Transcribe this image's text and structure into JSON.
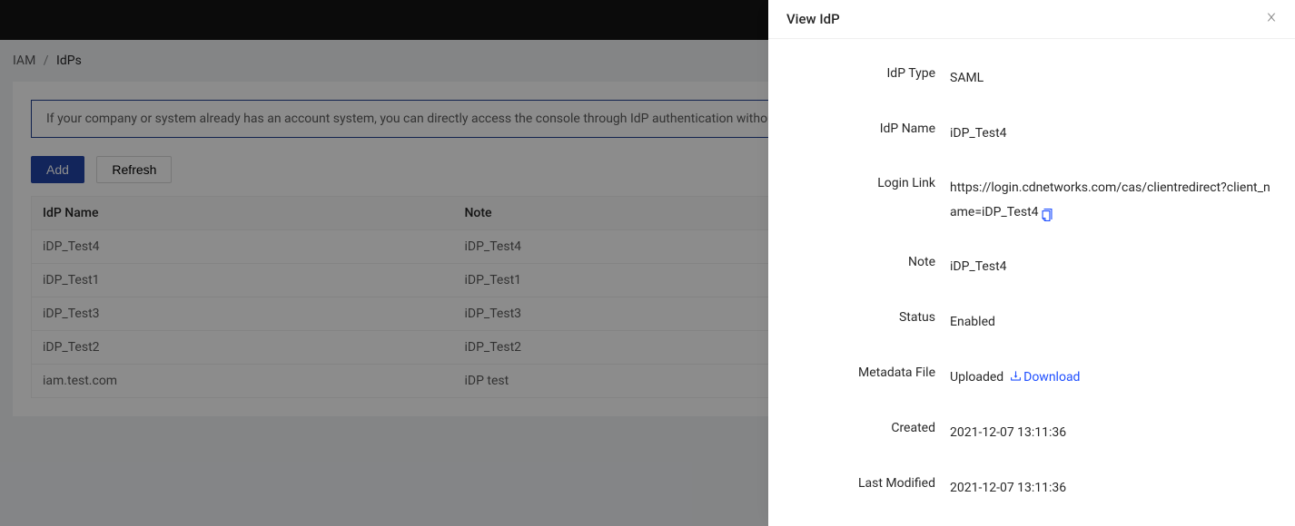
{
  "breadcrumb": {
    "root": "IAM",
    "current": "IdPs"
  },
  "info": {
    "text": "If your company or system already has an account system, you can directly access the console through IdP authentication without"
  },
  "actions": {
    "add_label": "Add",
    "refresh_label": "Refresh"
  },
  "table": {
    "headers": {
      "name": "IdP Name",
      "note": "Note"
    },
    "rows": [
      {
        "name": "iDP_Test4",
        "note": "iDP_Test4"
      },
      {
        "name": "iDP_Test1",
        "note": "iDP_Test1"
      },
      {
        "name": "iDP_Test3",
        "note": "iDP_Test3"
      },
      {
        "name": "iDP_Test2",
        "note": "iDP_Test2"
      },
      {
        "name": "iam.test.com",
        "note": "iDP test"
      }
    ]
  },
  "drawer": {
    "title": "View IdP",
    "labels": {
      "type": "IdP Type",
      "name": "IdP Name",
      "login_link": "Login Link",
      "note": "Note",
      "status": "Status",
      "metadata": "Metadata File",
      "created": "Created",
      "modified": "Last Modified"
    },
    "values": {
      "type": "SAML",
      "name": "iDP_Test4",
      "login_link": "https://login.cdnetworks.com/cas/clientredirect?client_name=iDP_Test4",
      "note": "iDP_Test4",
      "status": "Enabled",
      "metadata_status": "Uploaded",
      "download_label": "Download",
      "created": "2021-12-07 13:11:36",
      "modified": "2021-12-07 13:11:36"
    }
  }
}
